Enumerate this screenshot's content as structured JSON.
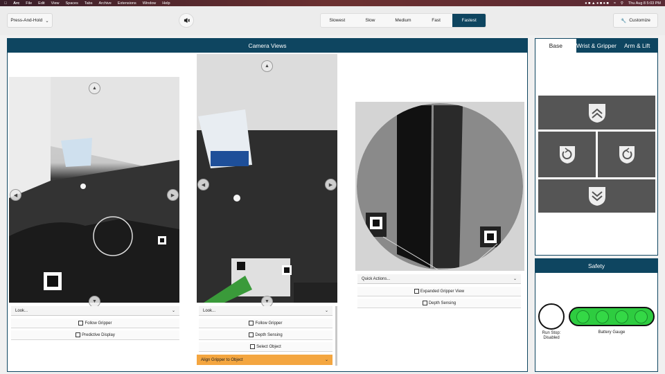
{
  "menubar": {
    "app": "Arc",
    "items": [
      "File",
      "Edit",
      "View",
      "Spaces",
      "Tabs",
      "Archive",
      "Extensions",
      "Window",
      "Help"
    ],
    "datetime": "Thu Aug 8  5:03 PM"
  },
  "toolbar": {
    "mode_label": "Press-And-Hold",
    "speeds": [
      "Slowest",
      "Slow",
      "Medium",
      "Fast",
      "Fastest"
    ],
    "active_speed": "Fastest",
    "customize_label": "Customize"
  },
  "camera_views": {
    "title": "Camera Views",
    "left": {
      "dropdown": "Look...",
      "options": [
        "Follow Gripper",
        "Predictive Display"
      ]
    },
    "middle": {
      "dropdown": "Look...",
      "options": [
        "Follow Gripper",
        "Depth Sensing",
        "Select Object"
      ],
      "action": "Align Gripper to Object"
    },
    "right": {
      "dropdown": "Quick Actions...",
      "options": [
        "Expanded Gripper View",
        "Depth Sensing"
      ]
    }
  },
  "control_tabs": {
    "tabs": [
      "Base",
      "Wrist & Gripper",
      "Arm & Lift"
    ],
    "active": "Base"
  },
  "safety": {
    "title": "Safety",
    "run_stop_label": "Run Stop: Disabled",
    "battery_label": "Battery Gauge"
  },
  "colors": {
    "accent": "#0e4560",
    "action_orange": "#f4a640",
    "battery_green": "#2ecc40"
  }
}
